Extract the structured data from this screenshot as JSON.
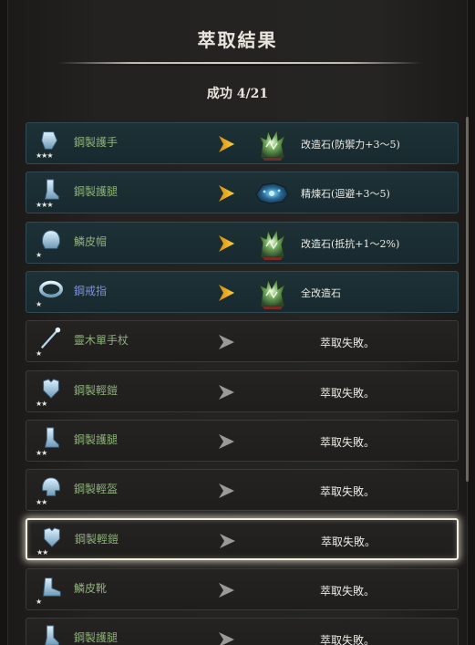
{
  "header": {
    "title": "萃取結果",
    "summary": "成功 4/21"
  },
  "results": [
    {
      "name": "鋼製護手",
      "stars": "★★★",
      "success": true,
      "reward_icon": "green-stone-icon",
      "reward": "改造石(防禦力+3～5)"
    },
    {
      "name": "鋼製護腿",
      "stars": "★★★",
      "success": true,
      "reward_icon": "blue-stone-icon",
      "reward": "精煉石(迴避+3～5)"
    },
    {
      "name": "鱗皮帽",
      "stars": "★",
      "success": true,
      "reward_icon": "green-stone-icon",
      "reward": "改造石(抵抗+1～2%)"
    },
    {
      "name": "鋼戒指",
      "stars": "★",
      "success": true,
      "name_color": "blue",
      "reward_icon": "green-stone-icon",
      "reward": "全改造石"
    },
    {
      "name": "靈木單手杖",
      "stars": "★",
      "success": false,
      "result": "萃取失敗。"
    },
    {
      "name": "鋼製輕鎧",
      "stars": "★★",
      "success": false,
      "result": "萃取失敗。"
    },
    {
      "name": "鋼製護腿",
      "stars": "★★",
      "success": false,
      "result": "萃取失敗。"
    },
    {
      "name": "鋼製輕盔",
      "stars": "★★",
      "success": false,
      "result": "萃取失敗。"
    },
    {
      "name": "鋼製輕鎧",
      "stars": "★★",
      "success": false,
      "selected": true,
      "result": "萃取失敗。"
    },
    {
      "name": "鱗皮靴",
      "stars": "★",
      "success": false,
      "result": "萃取失敗。"
    },
    {
      "name": "鋼製護腿",
      "stars": "",
      "success": false,
      "result": "萃取失敗。"
    }
  ],
  "colors": {
    "success_arrow": "#f4b51e",
    "fail_arrow": "#9c9a96",
    "item_name": "#8db07a",
    "item_name_blue": "#7d8fd8"
  }
}
